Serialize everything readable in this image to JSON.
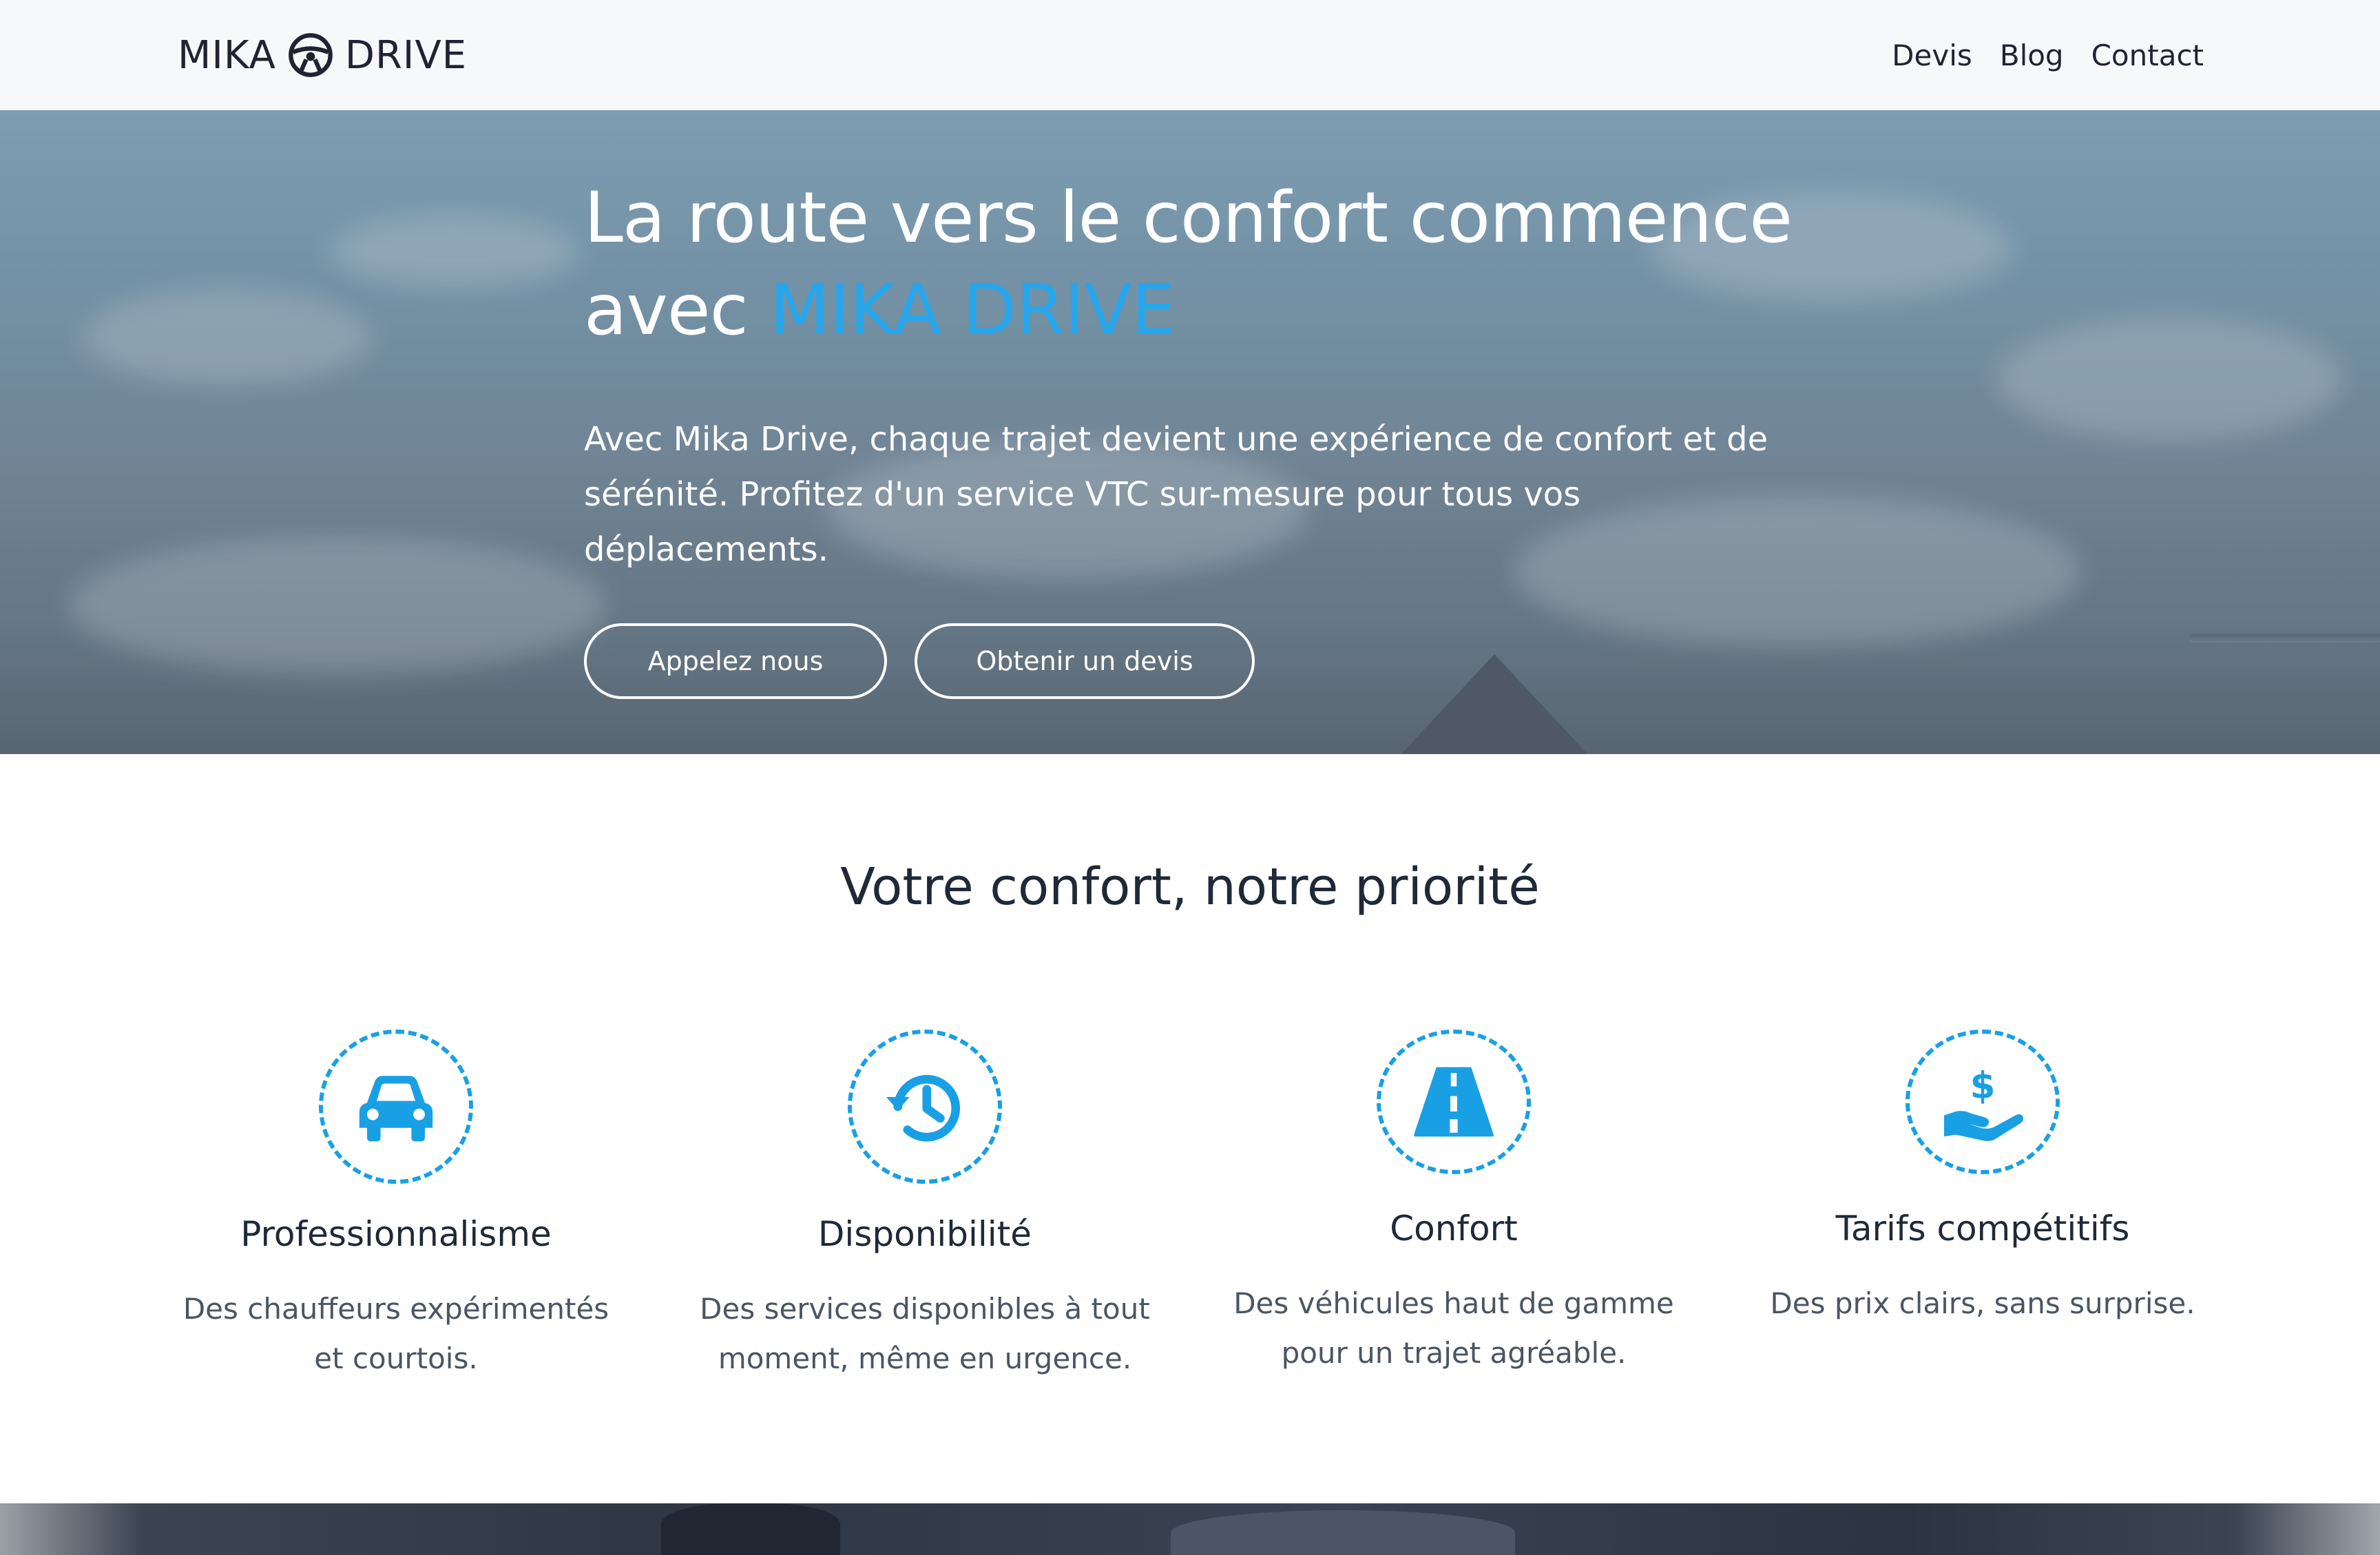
{
  "header": {
    "logo_left": "MIKA",
    "logo_right": "DRIVE",
    "logo_icon": "steering-wheel-icon",
    "nav": [
      {
        "label": "Devis"
      },
      {
        "label": "Blog"
      },
      {
        "label": "Contact"
      }
    ]
  },
  "hero": {
    "title_part1": "La route vers le confort commence avec",
    "title_accent": "MIKA DRIVE",
    "description": "Avec Mika Drive, chaque trajet devient une expérience de confort et de sérénité. Profitez d'un service VTC sur-mesure pour tous vos déplacements.",
    "buttons": {
      "call": "Appelez nous",
      "quote": "Obtenir un devis"
    }
  },
  "features": {
    "title": "Votre confort, notre priorité",
    "items": [
      {
        "icon": "car-icon",
        "title": "Professionnalisme",
        "text": "Des chauffeurs expérimentés et courtois."
      },
      {
        "icon": "history-clock-icon",
        "title": "Disponibilité",
        "text": "Des services disponibles à tout moment, même en urgence."
      },
      {
        "icon": "road-icon",
        "title": "Confort",
        "text": "Des véhicules haut de gamme pour un trajet agréable."
      },
      {
        "icon": "hand-dollar-icon",
        "title": "Tarifs compétitifs",
        "text": "Des prix clairs, sans surprise."
      }
    ]
  },
  "colors": {
    "accent": "#27a6ec",
    "icon_blue": "#19a0e4",
    "header_bg": "#f7f8fa",
    "text_dark": "#1f2937",
    "text_muted": "#4b5563"
  }
}
